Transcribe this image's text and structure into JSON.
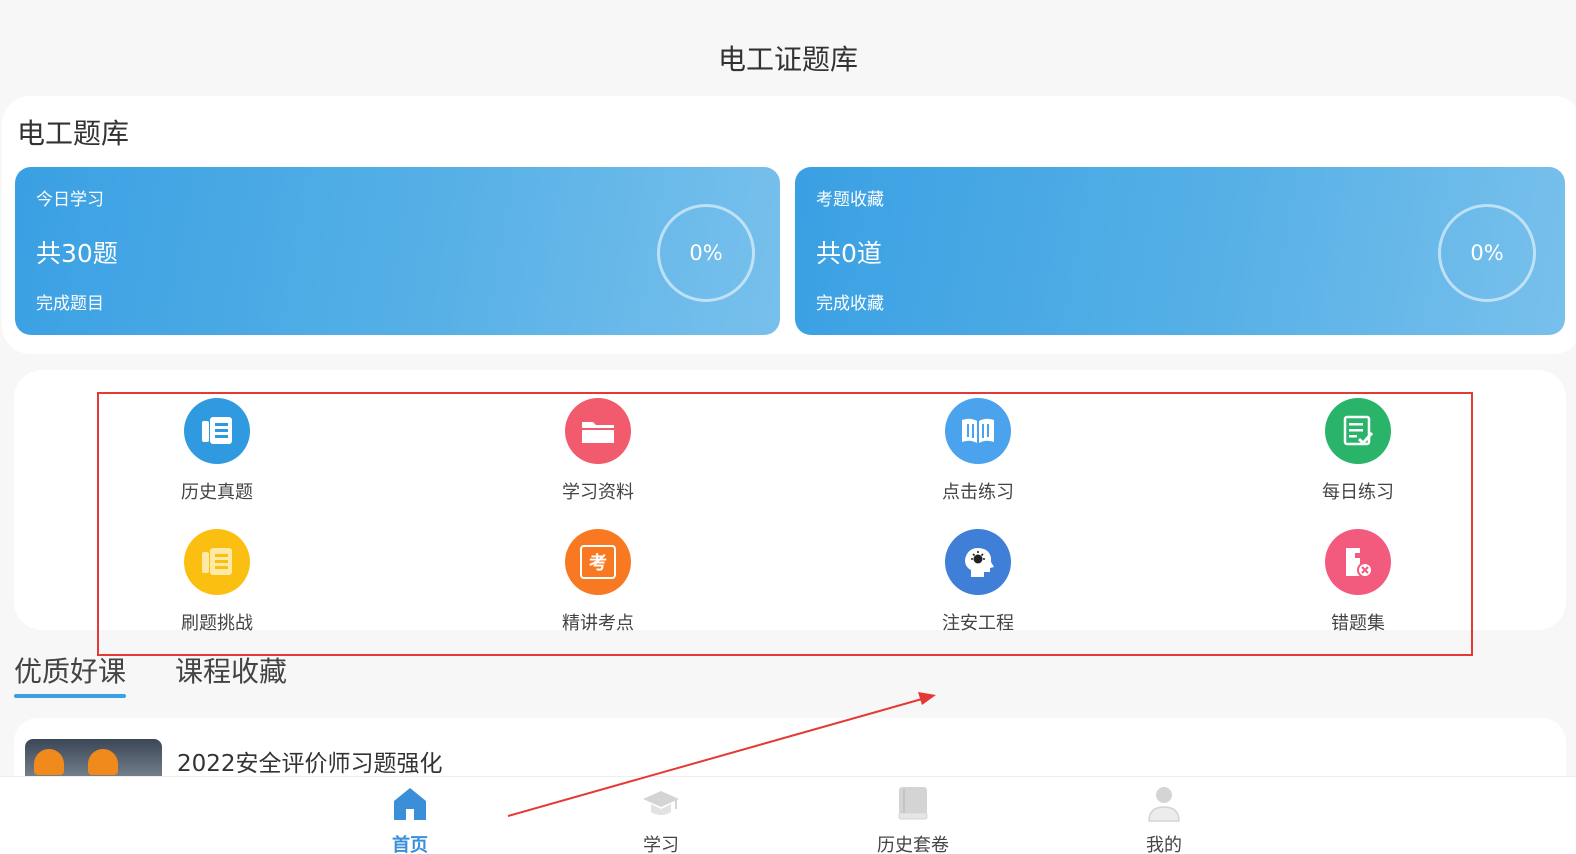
{
  "page": {
    "title": "电工证题库"
  },
  "bank": {
    "title": "电工题库",
    "cards": [
      {
        "label": "今日学习",
        "count": "共30题",
        "sub": "完成题目",
        "percent": "0%",
        "progress": 0
      },
      {
        "label": "考题收藏",
        "count": "共0道",
        "sub": "完成收藏",
        "percent": "0%",
        "progress": 0
      }
    ]
  },
  "functions": {
    "items": [
      {
        "label": "历史真题",
        "icon": "history-exam-icon",
        "color": "#2f9ae0"
      },
      {
        "label": "学习资料",
        "icon": "folder-icon",
        "color": "#f25a6e"
      },
      {
        "label": "点击练习",
        "icon": "open-book-icon",
        "color": "#4aa3ec"
      },
      {
        "label": "每日练习",
        "icon": "checklist-icon",
        "color": "#2ab46a"
      },
      {
        "label": "刷题挑战",
        "icon": "challenge-icon",
        "color": "#fbbf12"
      },
      {
        "label": "精讲考点",
        "icon": "exam-point-icon",
        "color": "#f87922",
        "glyph": "考"
      },
      {
        "label": "注安工程",
        "icon": "head-bulb-icon",
        "color": "#3f7fd8"
      },
      {
        "label": "错题集",
        "icon": "wrong-questions-icon",
        "color": "#f25a7e"
      }
    ]
  },
  "courses": {
    "tabs": [
      {
        "label": "优质好课",
        "active": true
      },
      {
        "label": "课程收藏",
        "active": false
      }
    ],
    "items": [
      {
        "title": "2022安全评价师习题强化"
      }
    ]
  },
  "nav": {
    "items": [
      {
        "label": "首页",
        "icon": "home-icon",
        "active": true
      },
      {
        "label": "学习",
        "icon": "graduation-cap-icon",
        "active": false
      },
      {
        "label": "历史套卷",
        "icon": "book-icon",
        "active": false
      },
      {
        "label": "我的",
        "icon": "user-icon",
        "active": false
      }
    ]
  },
  "colors": {
    "accent": "#3aa0e3",
    "nav_active": "#3a8fd8",
    "annotation": "#e53935"
  }
}
